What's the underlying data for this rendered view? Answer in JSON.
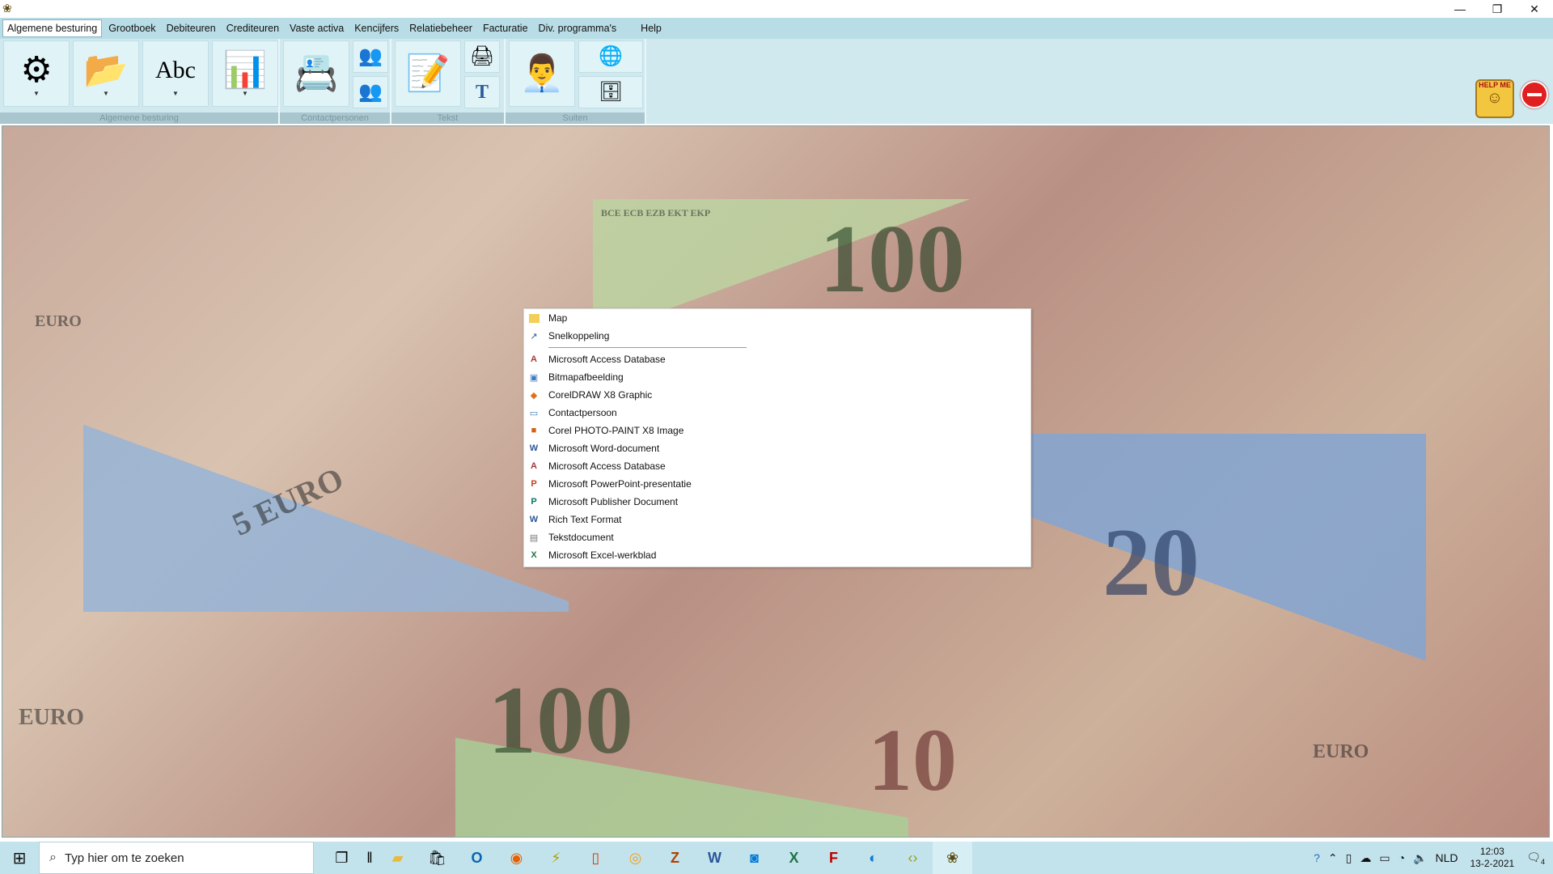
{
  "window": {
    "app_icon": "app-logo-icon",
    "controls": {
      "minimize": "—",
      "restore": "❐",
      "close": "✕"
    }
  },
  "menu": {
    "items": [
      {
        "label": "Algemene besturing",
        "active": true
      },
      {
        "label": "Grootboek"
      },
      {
        "label": "Debiteuren"
      },
      {
        "label": "Crediteuren"
      },
      {
        "label": "Vaste activa"
      },
      {
        "label": "Kencijfers"
      },
      {
        "label": "Relatiebeheer"
      },
      {
        "label": "Facturatie"
      },
      {
        "label": "Div. programma's"
      },
      {
        "label": "Help"
      }
    ]
  },
  "ribbon": {
    "groups": [
      {
        "label": "Algemene besturing"
      },
      {
        "label": "Contactpersonen"
      },
      {
        "label": "Tekst"
      },
      {
        "label": "Suiten"
      }
    ],
    "help_label": "HELP ME"
  },
  "context_menu": {
    "items": [
      {
        "label": "Map",
        "icon": "folder-icon"
      },
      {
        "label": "Snelkoppeling",
        "icon": "shortcut-icon"
      },
      {
        "label": "Microsoft Access Database",
        "icon": "access-icon"
      },
      {
        "label": "Bitmapafbeelding",
        "icon": "bitmap-icon"
      },
      {
        "label": "CorelDRAW X8 Graphic",
        "icon": "coreldraw-icon"
      },
      {
        "label": "Contactpersoon",
        "icon": "contact-icon"
      },
      {
        "label": "Corel PHOTO-PAINT X8 Image",
        "icon": "photopaint-icon"
      },
      {
        "label": "Microsoft Word-document",
        "icon": "word-icon"
      },
      {
        "label": "Microsoft Access Database",
        "icon": "access-icon"
      },
      {
        "label": "Microsoft PowerPoint-presentatie",
        "icon": "powerpoint-icon"
      },
      {
        "label": "Microsoft Publisher Document",
        "icon": "publisher-icon"
      },
      {
        "label": "Rich Text Format",
        "icon": "rtf-icon"
      },
      {
        "label": "Tekstdocument",
        "icon": "textdoc-icon"
      },
      {
        "label": "Microsoft Excel-werkblad",
        "icon": "excel-icon"
      }
    ]
  },
  "taskbar": {
    "search_placeholder": "Typ hier om te zoeken",
    "language": "NLD",
    "time": "12:03",
    "date": "13-2-2021",
    "notifications": "4"
  },
  "background": {
    "bill_labels": [
      "EURO",
      "100",
      "5 EURO",
      "20",
      "EURO",
      "100",
      "10",
      "EURO",
      "BCE ECB EZB EKT EKP"
    ]
  }
}
